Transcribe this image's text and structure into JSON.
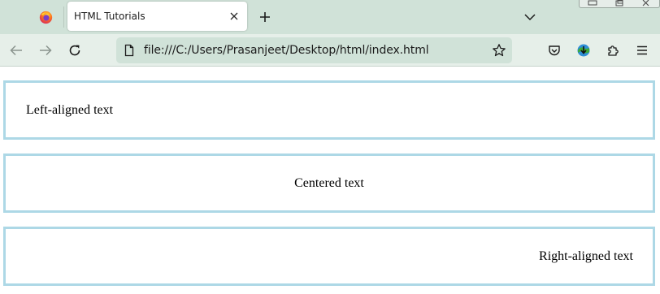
{
  "browser": {
    "tab": {
      "title": "HTML Tutorials"
    },
    "url": "file:///C:/Users/Prasanjeet/Desktop/html/index.html",
    "icons": {
      "app": "firefox-icon",
      "close_tab": "close-icon",
      "new_tab": "plus-icon",
      "list_tabs": "chevron-down-icon",
      "back": "arrow-left-icon",
      "forward": "arrow-right-icon",
      "reload": "reload-icon",
      "page": "page-icon",
      "bookmark": "star-icon",
      "pocket": "pocket-icon",
      "extension": "idm-extension-icon",
      "extensions": "puzzle-icon",
      "menu": "hamburger-icon"
    },
    "colors": {
      "tabstrip": "#d0e2d8",
      "navbar": "#e6efe9",
      "urlbar": "#d0e2d8"
    }
  },
  "page": {
    "boxes": [
      {
        "text": "Left-aligned text",
        "align": "left"
      },
      {
        "text": "Centered text",
        "align": "center"
      },
      {
        "text": "Right-aligned text",
        "align": "right"
      }
    ],
    "colors": {
      "box_border": "#add8e6",
      "text": "#000000"
    }
  }
}
